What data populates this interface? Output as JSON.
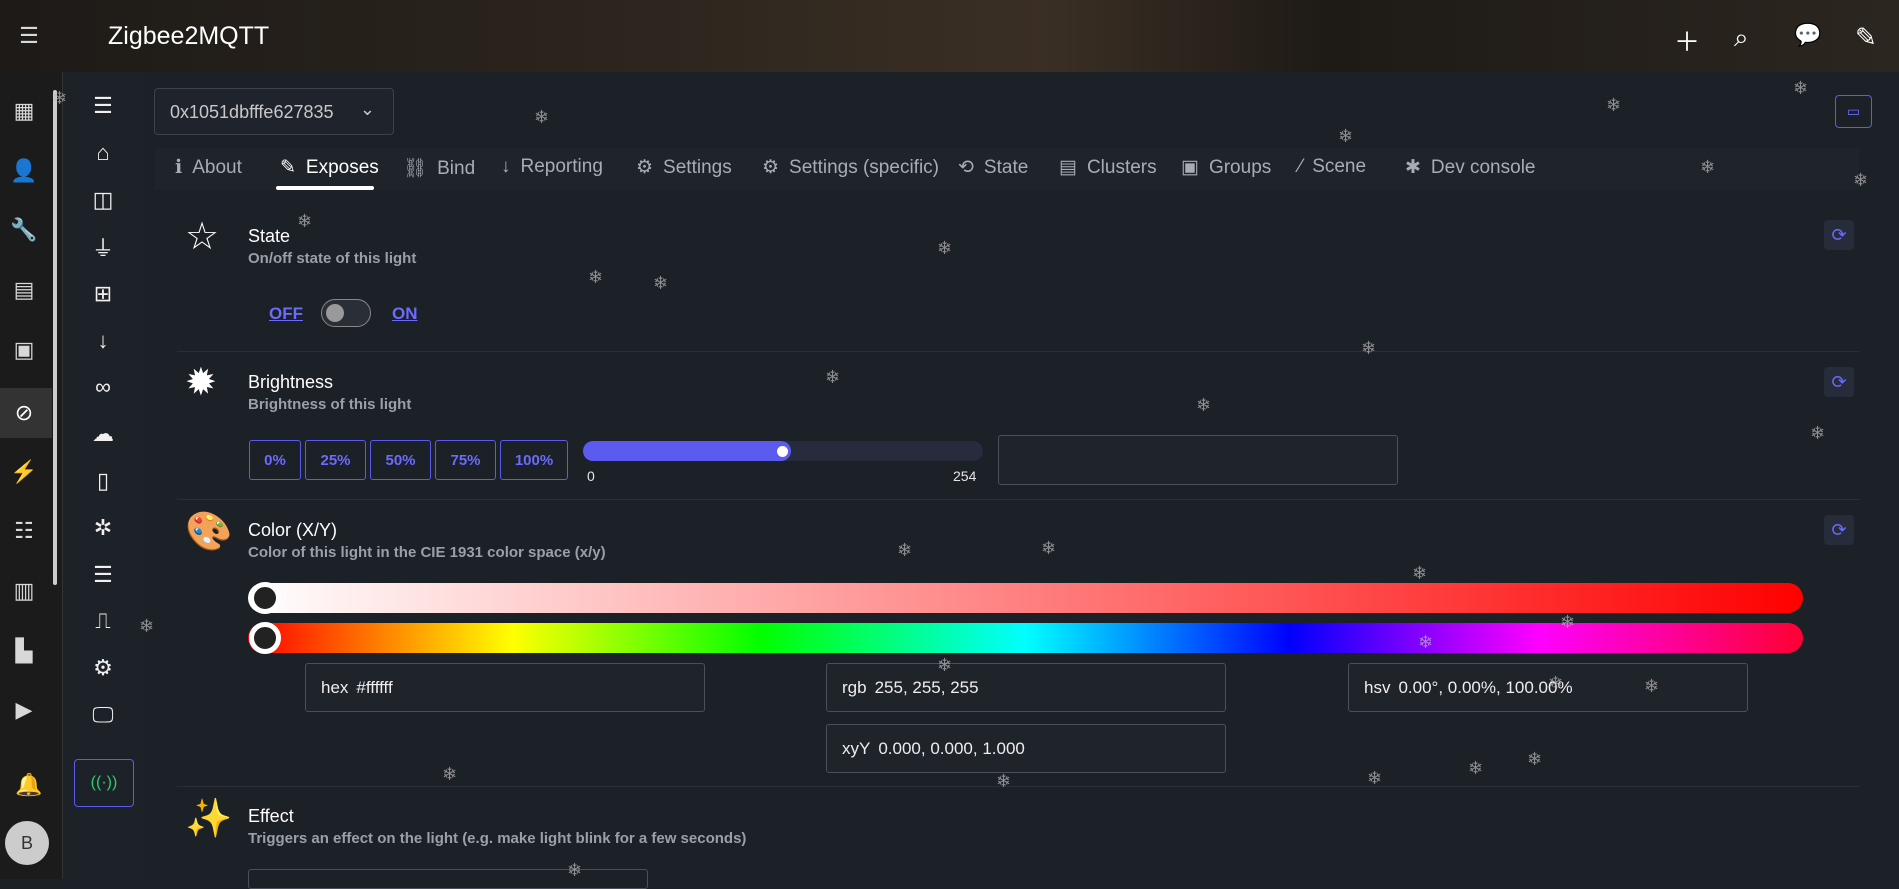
{
  "header": {
    "title": "Zigbee2MQTT"
  },
  "device_select": {
    "value": "0x1051dbfffe627835"
  },
  "tabs": [
    {
      "label": "About",
      "icon": "info-icon"
    },
    {
      "label": "Exposes",
      "icon": "pencil-icon",
      "active": true
    },
    {
      "label": "Bind",
      "icon": "link-icon"
    },
    {
      "label": "Reporting",
      "icon": "arrow-down-icon"
    },
    {
      "label": "Settings",
      "icon": "cogs-icon"
    },
    {
      "label": "Settings (specific)",
      "icon": "gear-icon"
    },
    {
      "label": "State",
      "icon": "sync-icon"
    },
    {
      "label": "Clusters",
      "icon": "receipt-icon"
    },
    {
      "label": "Groups",
      "icon": "group-icon"
    },
    {
      "label": "Scene",
      "icon": "magic-wand-icon"
    },
    {
      "label": "Dev console",
      "icon": "bug-icon"
    }
  ],
  "state": {
    "title": "State",
    "description": "On/off state of this light",
    "off_label": "OFF",
    "on_label": "ON",
    "value": "OFF"
  },
  "brightness": {
    "title": "Brightness",
    "description": "Brightness of this light",
    "presets": [
      "0%",
      "25%",
      "50%",
      "75%",
      "100%"
    ],
    "min": "0",
    "max": "254",
    "value": 127,
    "input_value": ""
  },
  "color": {
    "title": "Color (X/Y)",
    "description": "Color of this light in the CIE 1931 color space (x/y)",
    "hex_label": "hex",
    "hex": "#ffffff",
    "rgb_label": "rgb",
    "rgb": "255, 255, 255",
    "hsv_label": "hsv",
    "hsv": "0.00°, 0.00%, 100.00%",
    "xyy_label": "xyY",
    "xyy": "0.000, 0.000, 1.000"
  },
  "effect": {
    "title": "Effect",
    "description": "Triggers an effect on the light (e.g. make light blink for a few seconds)"
  },
  "user": {
    "avatar_letter": "B"
  },
  "colors": {
    "accent": "#6b6bff",
    "background": "#1c2027"
  }
}
